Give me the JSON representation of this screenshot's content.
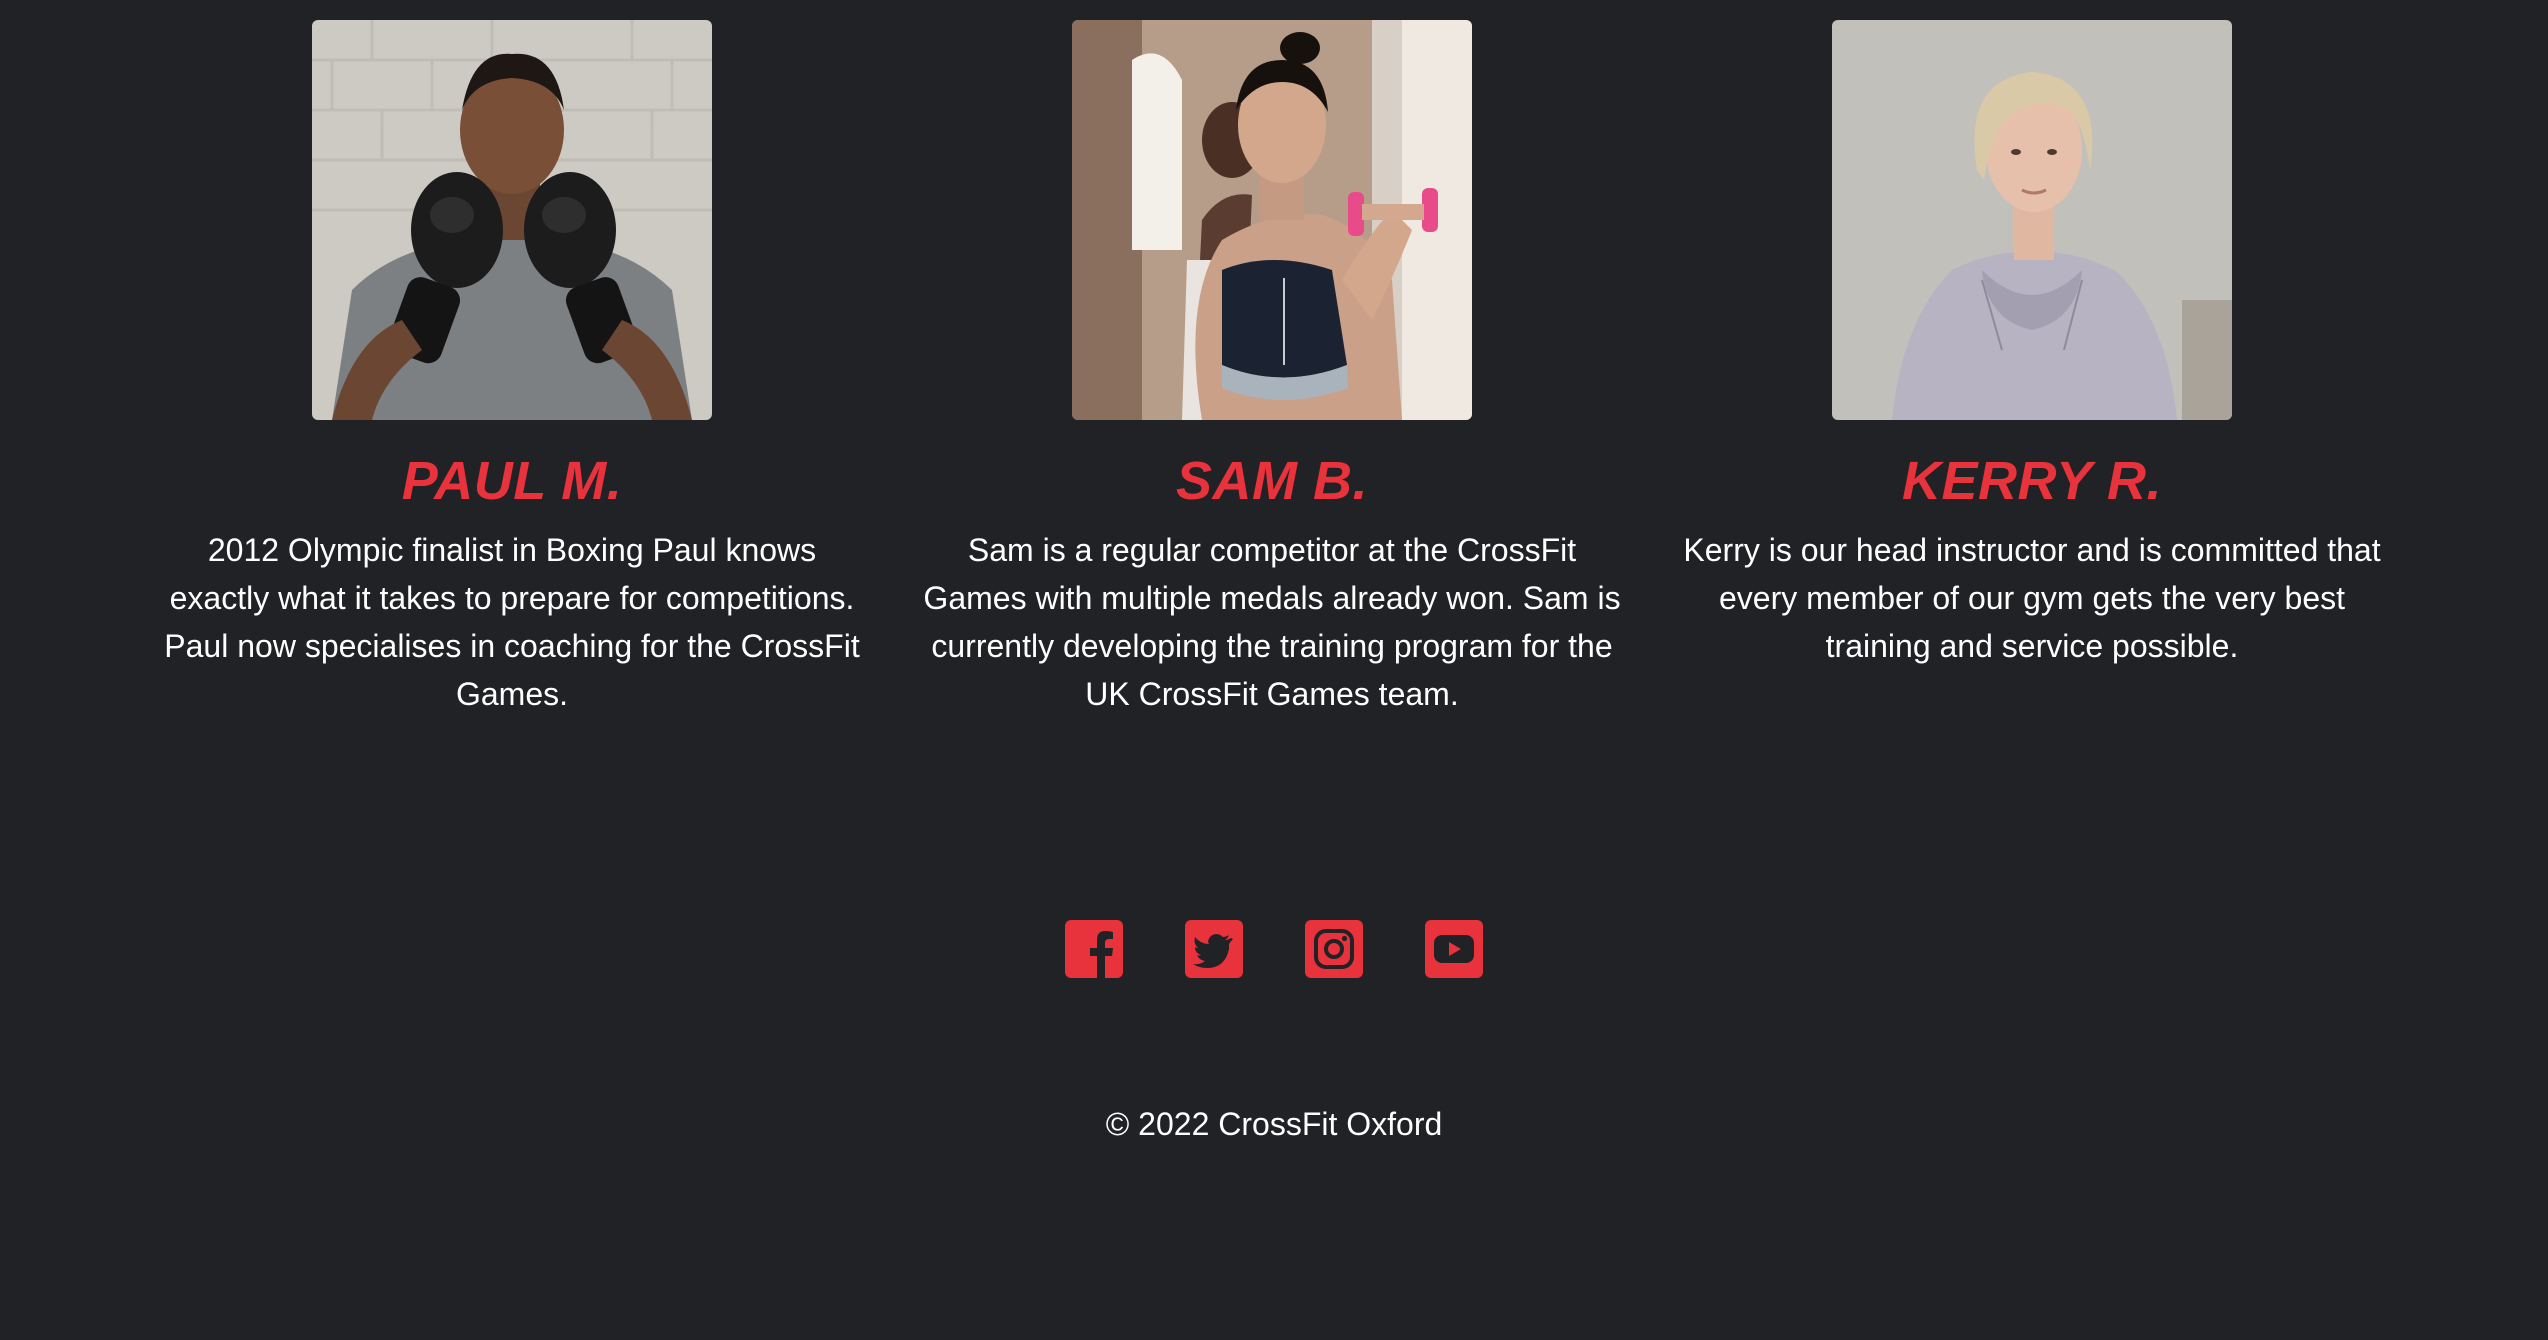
{
  "theme": {
    "accent": "#e8323c",
    "background": "#212226",
    "text": "#ffffff"
  },
  "instructors": [
    {
      "name": "PAUL M.",
      "bio": "2012 Olympic finalist in Boxing Paul knows exactly what it takes to prepare for competitions. Paul now specialises in coaching for the CrossFit Games."
    },
    {
      "name": "SAM B.",
      "bio": "Sam is a regular competitor at the CrossFit Games with multiple medals already won. Sam is currently developing the training program for the UK CrossFit Games team."
    },
    {
      "name": "KERRY R.",
      "bio": "Kerry is our head instructor and is committed that every member of our gym gets the very best training and service possible."
    }
  ],
  "social": {
    "icons": [
      "facebook-icon",
      "twitter-icon",
      "instagram-icon",
      "youtube-icon"
    ]
  },
  "footer": {
    "copyright": "© 2022 CrossFit Oxford"
  }
}
